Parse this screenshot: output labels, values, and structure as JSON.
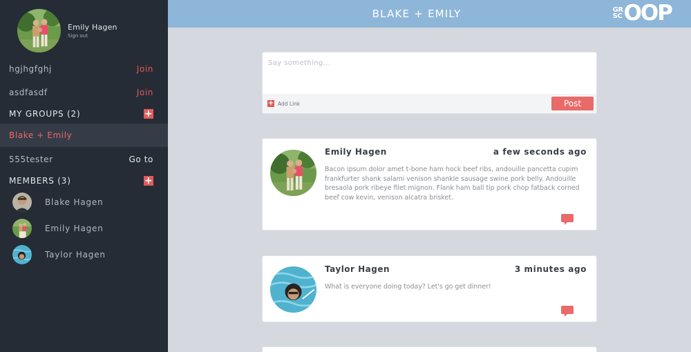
{
  "user": {
    "name": "Emily Hagen",
    "signout_label": "Sign out"
  },
  "sidebar": {
    "groups_to_join": [
      {
        "name": "hgjhgfghj",
        "action": "Join"
      },
      {
        "name": "asdfasdf",
        "action": "Join"
      }
    ],
    "my_groups_title": "MY GROUPS (2)",
    "my_groups": [
      {
        "name": "Blake + Emily",
        "active": true
      },
      {
        "name": "555tester",
        "action": "Go to"
      }
    ],
    "members_title": "MEMBERS (3)",
    "members": [
      {
        "name": "Blake Hagen"
      },
      {
        "name": "Emily Hagen"
      },
      {
        "name": "Taylor Hagen"
      }
    ],
    "add_symbol": "+"
  },
  "header": {
    "title": "BLAKE + EMILY",
    "logo": {
      "small_line1": "GR",
      "small_line2": "SC",
      "big": "OOP"
    }
  },
  "composer": {
    "placeholder": "Say something...",
    "add_link_label": "Add Link",
    "post_label": "Post"
  },
  "posts": [
    {
      "author": "Emily Hagen",
      "time": "a few seconds ago",
      "body": "Bacon ipsum dolor amet t-bone ham hock beef ribs, andouille pancetta cupim frankfurter shank salami venison shankle sausage swine pork belly. Andouille bresaola pork ribeye filet mignon. Flank ham ball tip pork chop fatback corned beef cow kevin, venison alcatra brisket."
    },
    {
      "author": "Taylor Hagen",
      "time": "3 minutes ago",
      "body": "What is everyone doing today? Let's go get dinner!"
    }
  ],
  "colors": {
    "accent": "#e05c5c",
    "sidebar_bg": "#262c35",
    "header_bg": "#8eb6d8",
    "page_bg": "#d5d9df"
  }
}
